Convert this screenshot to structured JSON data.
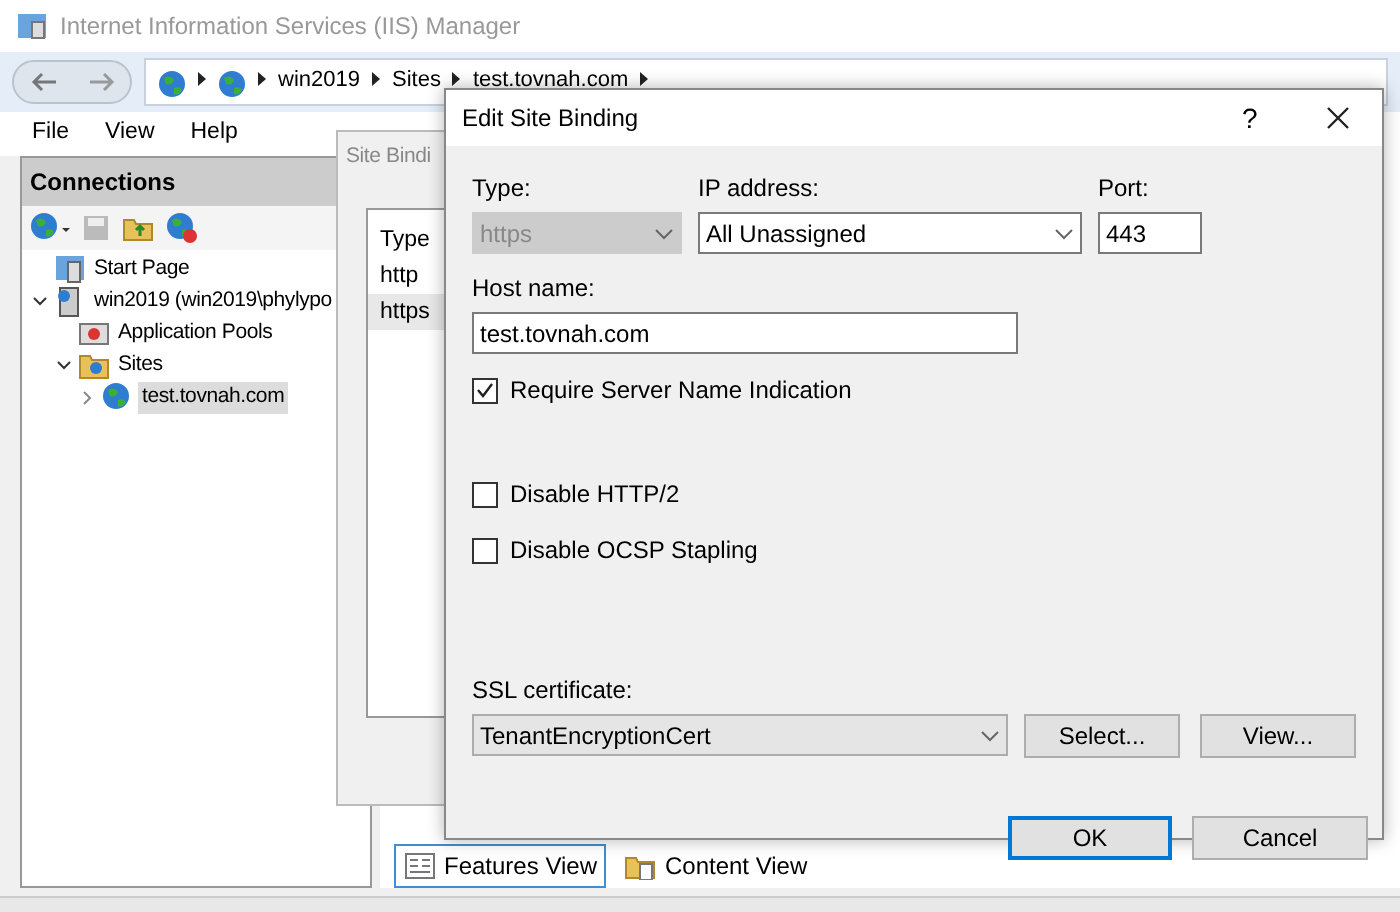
{
  "window": {
    "title": "Internet Information Services (IIS) Manager"
  },
  "breadcrumb": [
    "win2019",
    "Sites",
    "test.tovnah.com"
  ],
  "menu": [
    "File",
    "View",
    "Help"
  ],
  "connections": {
    "title": "Connections",
    "tree": [
      {
        "label": "Start Page",
        "kind": "start",
        "selected": false
      },
      {
        "label": "win2019 (win2019\\phylypo",
        "kind": "server",
        "selected": false,
        "expanded": true,
        "children": [
          {
            "label": "Application Pools",
            "kind": "pools",
            "selected": false
          },
          {
            "label": "Sites",
            "kind": "folder",
            "selected": false,
            "expanded": true,
            "children": [
              {
                "label": "test.tovnah.com",
                "kind": "site",
                "selected": true,
                "expanded": false
              }
            ]
          }
        ]
      }
    ]
  },
  "view_tabs": [
    {
      "label": "Features View",
      "selected": true
    },
    {
      "label": "Content View",
      "selected": false
    }
  ],
  "site_bindings": {
    "title": "Site Bindi",
    "column": "Type",
    "rows": [
      {
        "type": "http",
        "selected": false
      },
      {
        "type": "https",
        "selected": true
      }
    ]
  },
  "edit_dialog": {
    "title": "Edit Site Binding",
    "help": "?",
    "type": {
      "label": "Type:",
      "value": "https",
      "disabled": true
    },
    "ip": {
      "label": "IP address:",
      "value": "All Unassigned"
    },
    "port": {
      "label": "Port:",
      "value": "443"
    },
    "host": {
      "label": "Host name:",
      "value": "test.tovnah.com"
    },
    "options": [
      {
        "label": "Require Server Name Indication",
        "checked": true
      },
      {
        "label": "Disable HTTP/2",
        "checked": false
      },
      {
        "label": "Disable OCSP Stapling",
        "checked": false
      }
    ],
    "ssl": {
      "label": "SSL certificate:",
      "value": "TenantEncryptionCert"
    },
    "cert_buttons": [
      "Select...",
      "View..."
    ],
    "buttons": [
      {
        "label": "OK",
        "default": true
      },
      {
        "label": "Cancel",
        "default": false
      }
    ]
  }
}
